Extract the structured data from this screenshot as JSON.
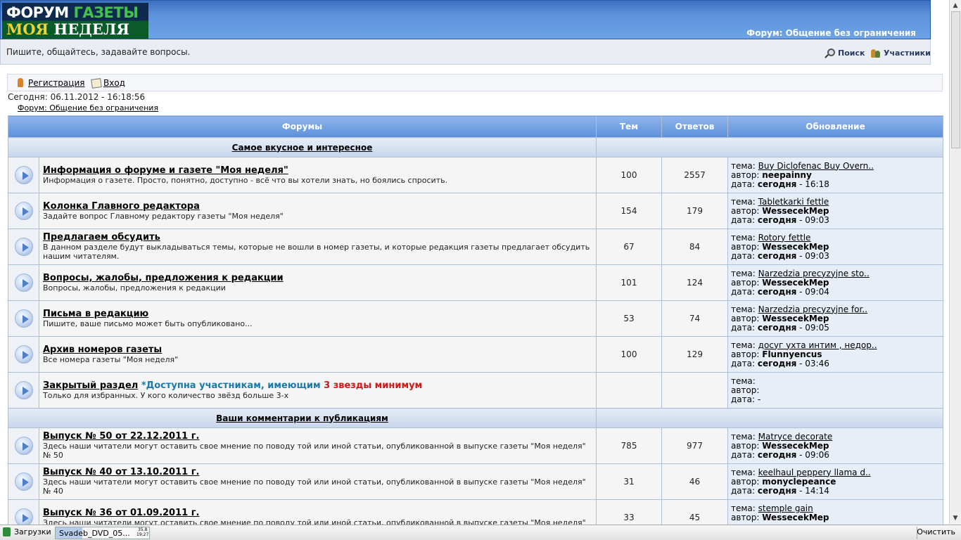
{
  "header": {
    "logo_line1_a": "ФОРУМ",
    "logo_line1_b": "ГАЗЕТЫ",
    "logo_line2_a": "МОЯ",
    "logo_line2_b": "НЕДЕЛЯ",
    "forum_title": "Форум: Общение без ограничения",
    "tagline": "Пишите, общайтесь, задавайте вопросы.",
    "search_label": "Поиск",
    "members_label": "Участники"
  },
  "auth": {
    "register_label": "Регистрация",
    "login_label": "Вход"
  },
  "today": "Сегодня: 06.11.2012 - 16:18:56",
  "breadcrumb": "Форум: Общение без ограничения",
  "table": {
    "headers": [
      "Форумы",
      "Тем",
      "Ответов",
      "Обновление"
    ],
    "update_labels": {
      "topic": "тема:",
      "author": "автор:",
      "date": "дата:"
    },
    "categories": [
      {
        "title": "Самое вкусное и интересное",
        "forums": [
          {
            "name": "Информация о форуме и газете \"Моя неделя\"",
            "desc": "Информация о газете. Просто, понятно, доступно - всё что вы хотели знать, но боялись спросить.",
            "topics": "100",
            "replies": "2557",
            "topic": "Buy Diclofenac Buy Overn..",
            "author": "neepainny",
            "date_bold": "сегодня",
            "date_time": " - 16:18"
          },
          {
            "name": "Колонка Главного редактора",
            "desc": "Задайте вопрос Главному редактору газеты \"Моя неделя\"",
            "topics": "154",
            "replies": "179",
            "topic": "Tabletkarki fettle",
            "author": "WessecekMep",
            "date_bold": "сегодня",
            "date_time": " - 09:03"
          },
          {
            "name": "Предлагаем обсудить",
            "desc": "В данном разделе будут выкладываться темы, которые не вошли в номер газеты, и которые редакция газеты предлагает обсудить нашим читателям.",
            "topics": "67",
            "replies": "84",
            "topic": "Rotory fettle",
            "author": "WessecekMep",
            "date_bold": "сегодня",
            "date_time": " - 09:03"
          },
          {
            "name": "Вопросы, жалобы, предложения к редакции",
            "desc": "Вопросы, жалобы, предложения к редакции",
            "topics": "101",
            "replies": "124",
            "topic": "Narzedzia precyzyjne sto..",
            "author": "WessecekMep",
            "date_bold": "сегодня",
            "date_time": " - 09:04"
          },
          {
            "name": "Письма в редакцию",
            "desc": "Пишите, ваше письмо может быть опубликовано...",
            "topics": "53",
            "replies": "74",
            "topic": "Narzedzia precyzyjne for..",
            "author": "WessecekMep",
            "date_bold": "сегодня",
            "date_time": " - 09:05"
          },
          {
            "name": "Архив номеров газеты",
            "desc": "Все номера газеты \"Моя неделя\"",
            "topics": "100",
            "replies": "129",
            "topic": "досуг ухта интим , недор..",
            "author": "Flunnyencus",
            "date_bold": "сегодня",
            "date_time": " - 03:46"
          },
          {
            "name": "Закрытый раздел",
            "note_blue": " *Доступна участникам, имеющим ",
            "note_red": "3 звезды минимум",
            "desc": "Только для избранных. У кого количество звёзд больше 3-х",
            "topics": "",
            "replies": "",
            "topic": "",
            "author": "",
            "date_bold": "",
            "date_time": " -"
          }
        ]
      },
      {
        "title": "Ваши комментарии к публикациям",
        "forums": [
          {
            "name": "Выпуск № 50 от 22.12.2011 г.",
            "desc": "Здесь наши читатели могут оставить свое мнение по поводу той или иной статьи, опубликованной в выпуске газеты \"Моя неделя\" № 50",
            "topics": "785",
            "replies": "977",
            "topic": "Matryce decorate",
            "author": "WessecekMep",
            "date_bold": "сегодня",
            "date_time": " - 09:06"
          },
          {
            "name": "Выпуск № 40 от 13.10.2011 г.",
            "desc": "Здесь наши читатели могут оставить свое мнение по поводу той или иной статьи, опубликованной в выпуске газеты \"Моя неделя\" № 40",
            "topics": "31",
            "replies": "46",
            "topic": "keelhaul peppery llama d..",
            "author": "monyclepeance",
            "date_bold": "сегодня",
            "date_time": " - 14:14"
          },
          {
            "name": "Выпуск № 36 от 01.09.2011 г.",
            "desc": "Здесь наши читатели могут оставить свое мнение по поводу той или иной статьи, опубликованной в выпуске газеты \"Моя неделя\"",
            "topics": "33",
            "replies": "45",
            "topic": "stemple gain",
            "author": "WessecekMep",
            "date_bold": "",
            "date_time": ""
          }
        ]
      }
    ]
  },
  "downloads": {
    "label": "Загрузки",
    "item": "Svadeb_DVD_05...",
    "size_done": "35.8",
    "size_total": "19:27",
    "clear": "Очистить"
  }
}
